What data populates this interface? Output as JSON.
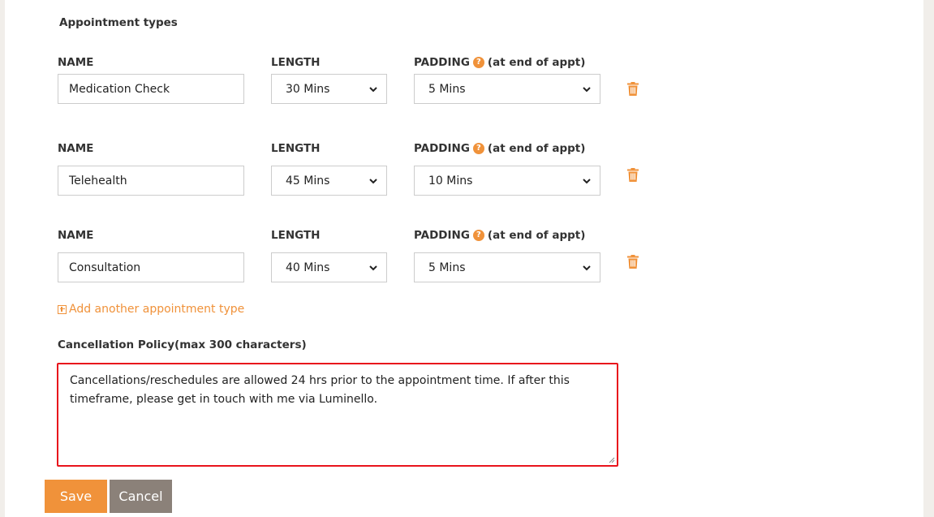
{
  "section": {
    "title": "Appointment types"
  },
  "labels": {
    "name": "NAME",
    "length": "LENGTH",
    "padding": "PADDING",
    "padding_suffix": "(at end of appt)",
    "help_glyph": "?"
  },
  "appointment_types": [
    {
      "name": "Medication Check",
      "length": "30 Mins",
      "padding": "5 Mins"
    },
    {
      "name": "Telehealth",
      "length": "45 Mins",
      "padding": "10 Mins"
    },
    {
      "name": "Consultation",
      "length": "40 Mins",
      "padding": "5 Mins"
    }
  ],
  "add_link": {
    "label": "Add another appointment type"
  },
  "cancellation": {
    "label": "Cancellation Policy(max 300 characters)",
    "value": "Cancellations/reschedules are allowed 24 hrs prior to the appointment time. If after this timeframe, please get in touch with me via Luminello."
  },
  "buttons": {
    "save": "Save",
    "cancel": "Cancel"
  },
  "colors": {
    "accent": "#f0923a",
    "cancel_button": "#8b8179",
    "highlight_border": "#e8141c"
  },
  "icons": {
    "help": "question-circle-icon",
    "delete": "trash-icon",
    "add": "plus-square-icon",
    "dropdown": "chevron-down-icon"
  }
}
